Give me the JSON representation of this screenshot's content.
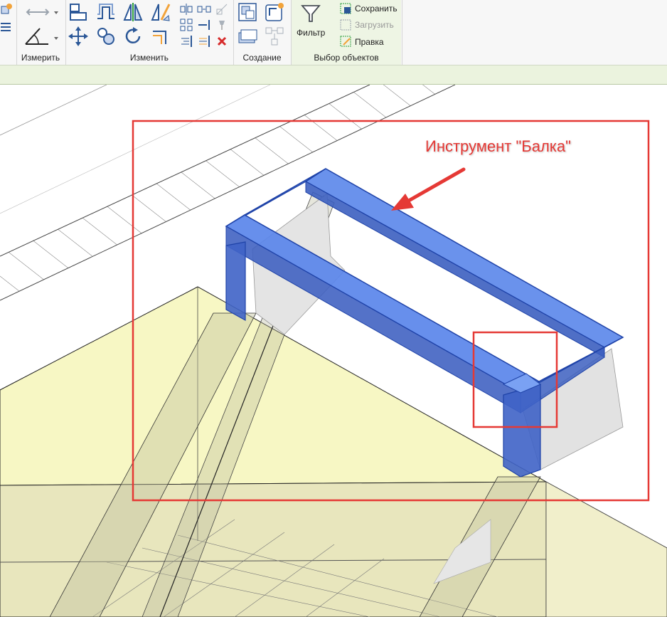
{
  "ribbon": {
    "panels": {
      "measure": {
        "label": "Измерить"
      },
      "modify": {
        "label": "Изменить"
      },
      "create": {
        "label": "Создание"
      },
      "selection": {
        "label": "Выбор объектов"
      }
    },
    "filter_label": "Фильтр",
    "save_label": "Сохранить",
    "load_label": "Загрузить",
    "edit_label": "Правка"
  },
  "viewport": {
    "annotation": "Инструмент \"Балка\"",
    "annotation_color": "#e53935",
    "beam_color": "#4a78e6",
    "slab_color": "#f7f7c4"
  },
  "icons": [
    "dimension-icon",
    "angle-icon",
    "align-icon",
    "offset-icon",
    "mirror-icon",
    "move-icon",
    "copy-icon",
    "rotate-icon",
    "trim-icon",
    "split-icon",
    "array-icon",
    "pin-icon",
    "delete-icon",
    "group-icon",
    "filter-icon"
  ]
}
